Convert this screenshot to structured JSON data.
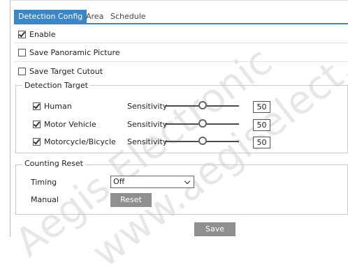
{
  "tabs": [
    {
      "label": "Detection Config"
    },
    {
      "label": "Area"
    },
    {
      "label": "Schedule"
    }
  ],
  "enable": {
    "label": "Enable",
    "checked": true
  },
  "save_panoramic": {
    "label": "Save Panoramic Picture",
    "checked": false
  },
  "save_target_cutout": {
    "label": "Save Target Cutout",
    "checked": false
  },
  "detection_target": {
    "legend": "Detection Target",
    "sensitivity_label": "Sensitivity",
    "items": [
      {
        "label": "Human",
        "checked": true,
        "sensitivity": 50
      },
      {
        "label": "Motor Vehicle",
        "checked": true,
        "sensitivity": 50
      },
      {
        "label": "Motorcycle/Bicycle",
        "checked": true,
        "sensitivity": 50
      }
    ]
  },
  "counting_reset": {
    "legend": "Counting Reset",
    "timing_label": "Timing",
    "timing_value": "Off",
    "manual_label": "Manual",
    "reset_button": "Reset"
  },
  "save_button": "Save",
  "watermark": {
    "line1": "Aegis Electronic",
    "line2": "www.aegiselect.com"
  },
  "colors": {
    "accent": "#3d86c6",
    "button_gray": "#8f8f8f"
  }
}
